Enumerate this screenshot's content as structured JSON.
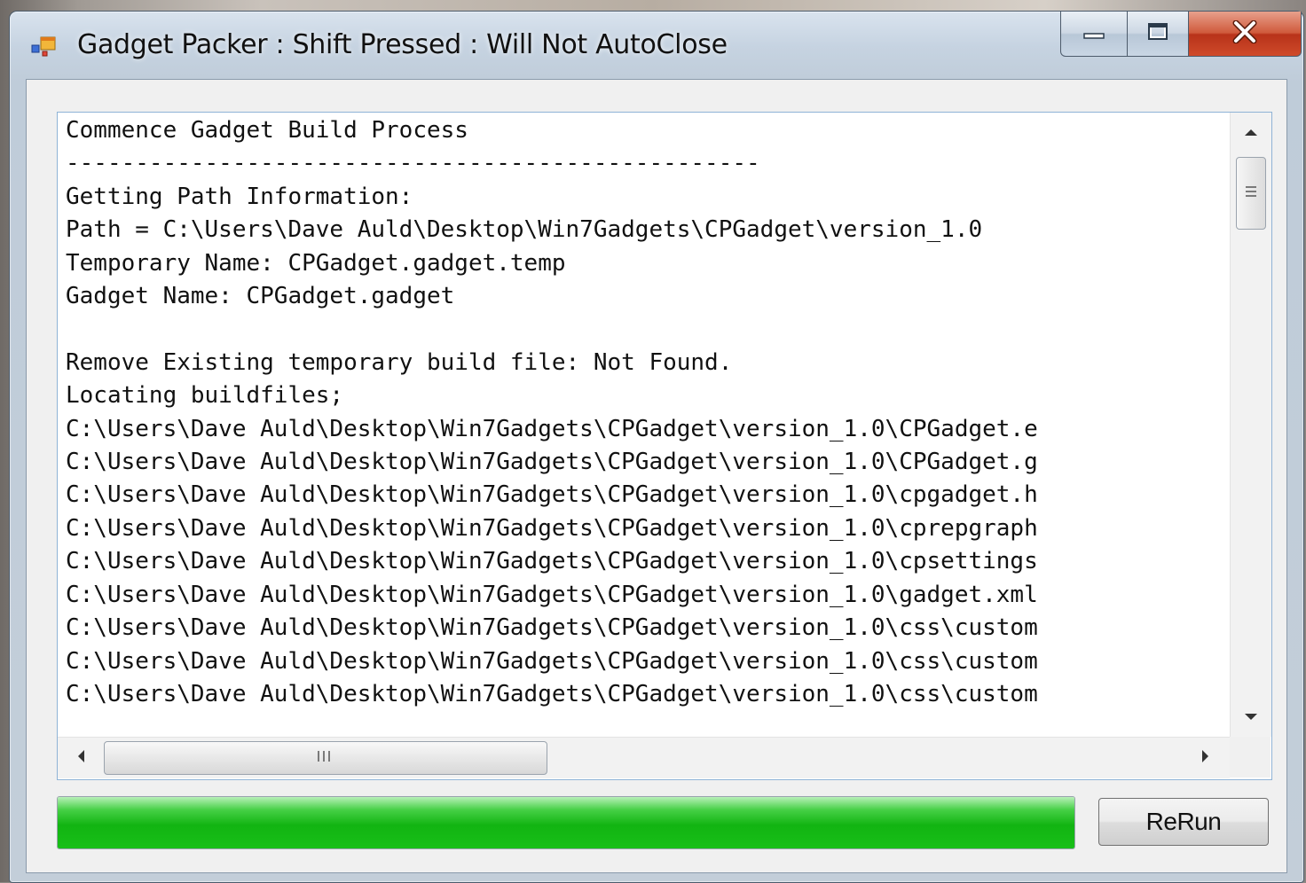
{
  "window": {
    "title": "Gadget Packer : Shift Pressed : Will Not AutoClose",
    "icon": "app-window-icon",
    "controls": {
      "minimize_icon": "minimize-icon",
      "maximize_icon": "maximize-icon",
      "close_icon": "close-icon"
    }
  },
  "log": {
    "lines": [
      "Commence Gadget Build Process",
      "--------------------------------------------------",
      "Getting Path Information:",
      "Path = C:\\Users\\Dave Auld\\Desktop\\Win7Gadgets\\CPGadget\\version_1.0",
      "Temporary Name: CPGadget.gadget.temp",
      "Gadget Name: CPGadget.gadget",
      "",
      "Remove Existing temporary build file: Not Found.",
      "Locating buildfiles;",
      "C:\\Users\\Dave Auld\\Desktop\\Win7Gadgets\\CPGadget\\version_1.0\\CPGadget.e",
      "C:\\Users\\Dave Auld\\Desktop\\Win7Gadgets\\CPGadget\\version_1.0\\CPGadget.g",
      "C:\\Users\\Dave Auld\\Desktop\\Win7Gadgets\\CPGadget\\version_1.0\\cpgadget.h",
      "C:\\Users\\Dave Auld\\Desktop\\Win7Gadgets\\CPGadget\\version_1.0\\cprepgraph",
      "C:\\Users\\Dave Auld\\Desktop\\Win7Gadgets\\CPGadget\\version_1.0\\cpsettings",
      "C:\\Users\\Dave Auld\\Desktop\\Win7Gadgets\\CPGadget\\version_1.0\\gadget.xml",
      "C:\\Users\\Dave Auld\\Desktop\\Win7Gadgets\\CPGadget\\version_1.0\\css\\custom",
      "C:\\Users\\Dave Auld\\Desktop\\Win7Gadgets\\CPGadget\\version_1.0\\css\\custom",
      "C:\\Users\\Dave Auld\\Desktop\\Win7Gadgets\\CPGadget\\version_1.0\\css\\custom"
    ]
  },
  "progress": {
    "fraction": 1.0,
    "color": "#18c018"
  },
  "buttons": {
    "rerun_label": "ReRun"
  }
}
